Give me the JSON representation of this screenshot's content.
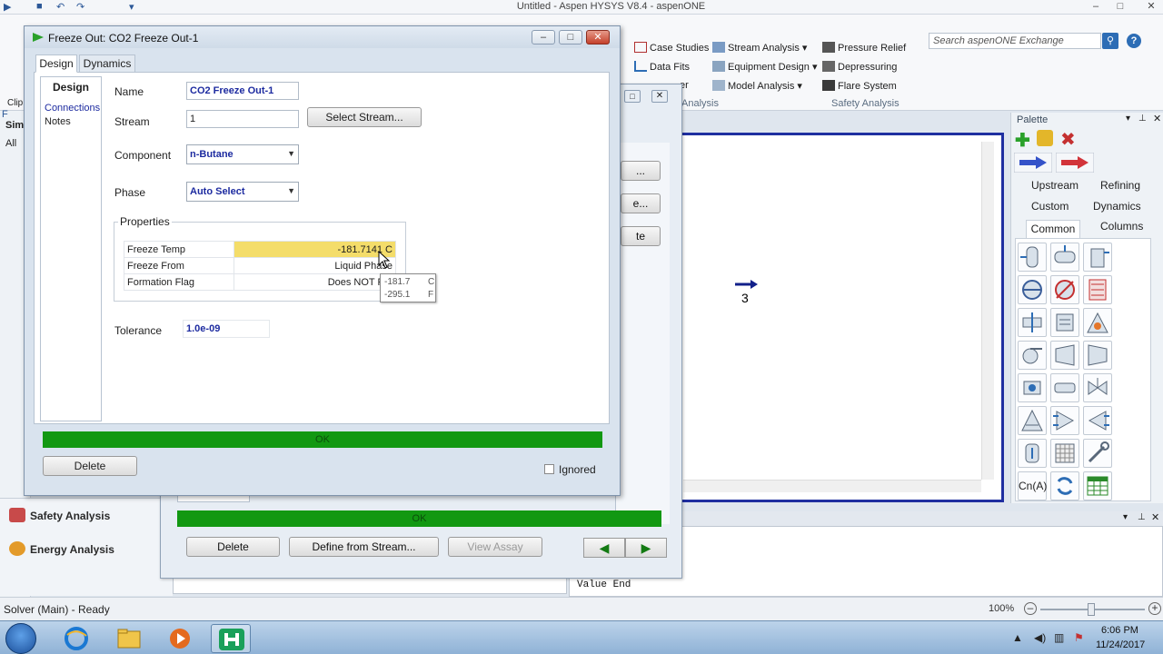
{
  "app": {
    "title": "Untitled - Aspen HYSYS V8.4 - aspenONE",
    "search_placeholder": "Search aspenONE Exchange",
    "help": "?",
    "accent": "#2d6db5"
  },
  "ribbon": {
    "items": [
      "Case Studies",
      "Data Fits",
      "Stream Analysis",
      "Equipment Design",
      "Model Analysis",
      "Pressure Relief",
      "Depressuring",
      "Flare System"
    ],
    "partial_left": "er",
    "groups": [
      "Analysis",
      "Safety Analysis"
    ]
  },
  "left_nav": {
    "partial_labels": [
      "F",
      "Clip",
      "Sim",
      "All"
    ],
    "bottom_items": [
      "Safety Analysis",
      "Energy Analysis"
    ]
  },
  "dialog": {
    "title": "Freeze Out: CO2 Freeze Out-1",
    "tabs": [
      "Design",
      "Dynamics"
    ],
    "side_nav_title": "Design",
    "side_links": [
      "Connections",
      "Notes"
    ],
    "fields": {
      "name_label": "Name",
      "name_value": "CO2 Freeze Out-1",
      "stream_label": "Stream",
      "stream_value": "1",
      "select_stream_button": "Select Stream...",
      "component_label": "Component",
      "component_value": "n-Butane",
      "phase_label": "Phase",
      "phase_value": "Auto Select",
      "tolerance_label": "Tolerance",
      "tolerance_value": "1.0e-09"
    },
    "properties": {
      "legend": "Properties",
      "rows": [
        {
          "label": "Freeze Temp",
          "value": "-181.7141 C"
        },
        {
          "label": "Freeze From",
          "value": "Liquid Phase"
        },
        {
          "label": "Formation Flag",
          "value": "Does NOT For"
        }
      ]
    },
    "tooltip": [
      {
        "value": "-181.7",
        "unit": "C"
      },
      {
        "value": "-295.1",
        "unit": "F"
      }
    ],
    "status": "OK",
    "delete_button": "Delete",
    "ignored_label": "Ignored",
    "ok_color": "#129812"
  },
  "background_dialog": {
    "status": "OK",
    "buttons": [
      "Delete",
      "Define from Stream...",
      "View Assay"
    ],
    "partial_buttons": [
      "...",
      "e...",
      "te"
    ]
  },
  "flowsheet": {
    "stream_label": "3"
  },
  "palette": {
    "title": "Palette",
    "categories": [
      "Upstream",
      "Refining",
      "Custom",
      "Dynamics",
      "Common",
      "Columns"
    ],
    "extra_label": "Cn(A)"
  },
  "output": {
    "text": "Value End"
  },
  "statusbar": {
    "text": "Solver (Main) - Ready",
    "zoom": "100%"
  },
  "taskbar": {
    "time": "6:06 PM",
    "date": "11/24/2017"
  }
}
